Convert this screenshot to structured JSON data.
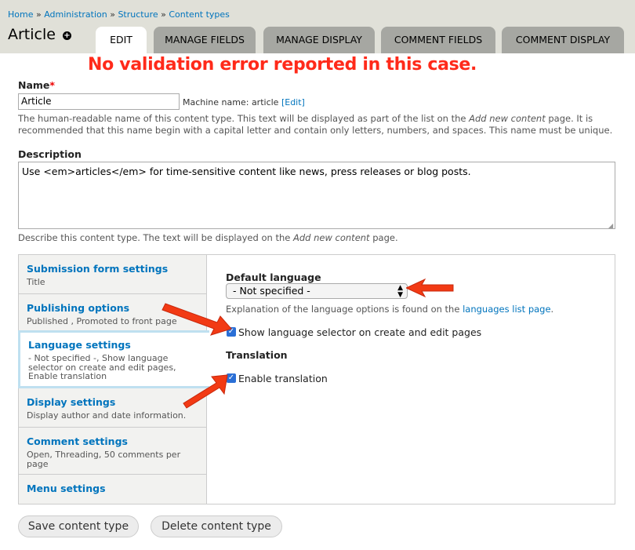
{
  "breadcrumb": [
    "Home",
    "Administration",
    "Structure",
    "Content types"
  ],
  "breadcrumb_sep": "»",
  "title": "Article",
  "shortcut_icon": "+",
  "tabs": [
    "EDIT",
    "MANAGE FIELDS",
    "MANAGE DISPLAY",
    "COMMENT FIELDS",
    "COMMENT DISPLAY"
  ],
  "annotation": "No validation error reported in this case.",
  "name_field": {
    "label": "Name",
    "required_mark": "*",
    "value": "Article",
    "machine_name_label": "Machine name: article",
    "machine_name_edit": "[Edit]",
    "help_1": "The human-readable name of this content type. This text will be displayed as part of the list on the",
    "help_em": "Add new content",
    "help_2": "page. It is recommended that this name begin with a capital letter and contain only letters, numbers, and spaces. This name must be unique."
  },
  "description_field": {
    "label": "Description",
    "value": "Use <em>articles</em> for time-sensitive content like news, press releases or blog posts.",
    "help_1": "Describe this content type. The text will be displayed on the",
    "help_em": "Add new content",
    "help_2": "page."
  },
  "vertical_tabs": [
    {
      "title": "Submission form settings",
      "summary": "Title"
    },
    {
      "title": "Publishing options",
      "summary": "Published , Promoted to front page"
    },
    {
      "title": "Language settings",
      "summary": "- Not specified -, Show language selector on create and edit pages, Enable translation"
    },
    {
      "title": "Display settings",
      "summary": "Display author and date information."
    },
    {
      "title": "Comment settings",
      "summary": "Open, Threading, 50 comments per page"
    },
    {
      "title": "Menu settings",
      "summary": ""
    }
  ],
  "language_pane": {
    "default_language_label": "Default language",
    "default_language_value": "- Not specified -",
    "explanation_text": "Explanation of the language options is found on the",
    "explanation_link": "languages list page",
    "explanation_end": ".",
    "show_selector_label": "Show language selector on create and edit pages",
    "translation_heading": "Translation",
    "enable_translation_label": "Enable translation"
  },
  "actions": {
    "save": "Save content type",
    "delete": "Delete content type"
  },
  "colors": {
    "link": "#0074bd",
    "annotation": "#ff2a1a",
    "header_bg": "#e0e0d8",
    "tab_bg": "#a6a7a2"
  }
}
